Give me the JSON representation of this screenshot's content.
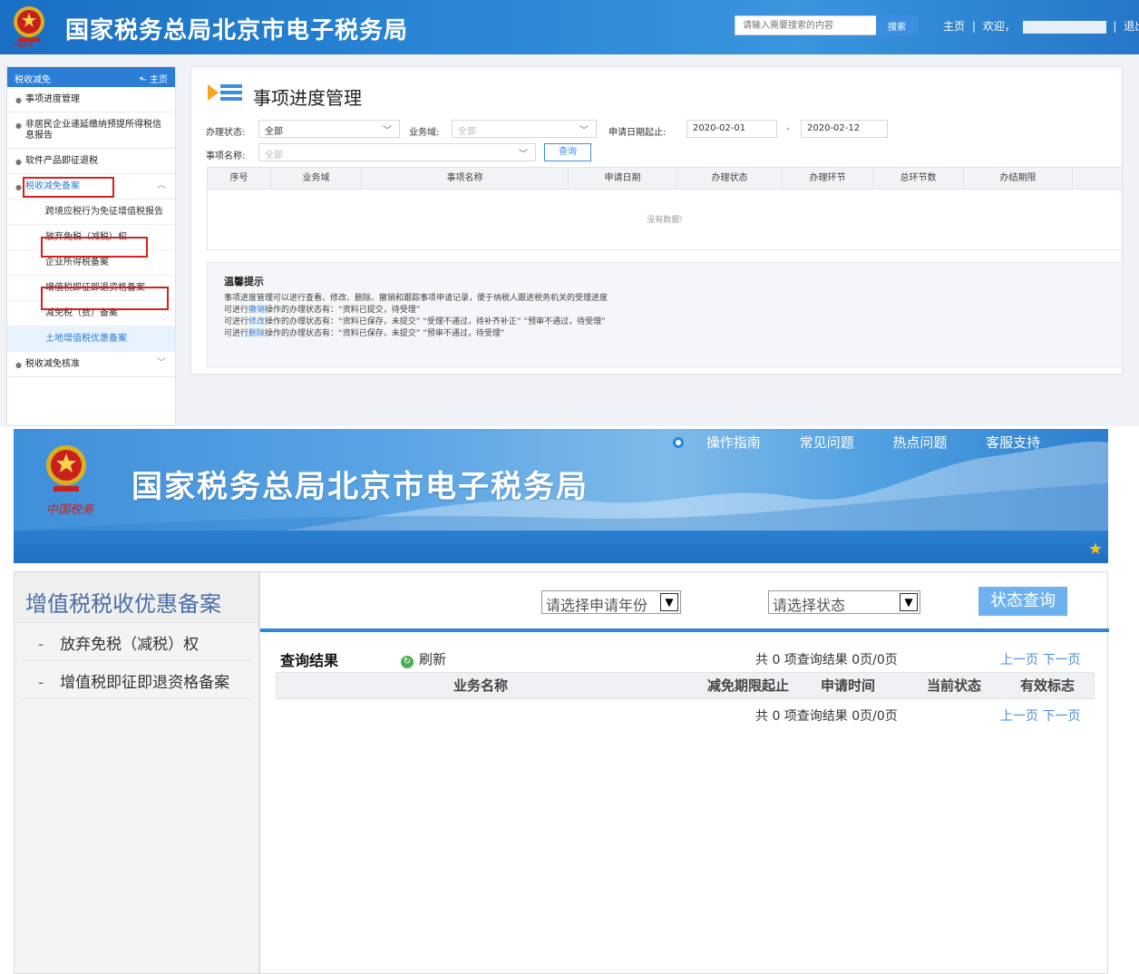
{
  "top": {
    "header": {
      "title": "国家税务总局北京市电子税务局",
      "search_placeholder": "请输入需要搜索的内容",
      "search_button": "搜索",
      "home": "主页",
      "sep1": "|",
      "welcome": "欢迎，",
      "sep2": "|",
      "logout": "退出"
    },
    "sidebar": {
      "head": "税收减免",
      "home": "主页",
      "items": [
        {
          "label": "事项进度管理"
        },
        {
          "label": "非居民企业递延缴纳预提所得税信息报告"
        },
        {
          "label": "软件产品即征退税"
        },
        {
          "label": "税收减免备案"
        }
      ],
      "subitems": [
        {
          "label": "跨境应税行为免征增值税报告"
        },
        {
          "label": "放弃免税（减税）权"
        },
        {
          "label": "企业所得税备案"
        },
        {
          "label": "增值税即征即退资格备案"
        },
        {
          "label": "减免税（费）备案"
        },
        {
          "label": "土地增值税优惠备案"
        }
      ],
      "last_item": "税收减免核准"
    },
    "main": {
      "title": "事项进度管理",
      "filters": {
        "status_label": "办理状态:",
        "status_value": "全部",
        "domain_label": "业务域:",
        "domain_value": "全部",
        "date_label": "申请日期起止:",
        "date_from": "2020-02-01",
        "date_sep": "-",
        "date_to": "2020-02-12",
        "name_label": "事项名称:",
        "name_value": "全部",
        "query_button": "查询"
      },
      "table": {
        "columns": [
          "序号",
          "业务域",
          "事项名称",
          "申请日期",
          "办理状态",
          "办理环节",
          "总环节数",
          "办结期限"
        ],
        "empty": "没有数据!"
      },
      "tips": {
        "title": "温馨提示",
        "line1": "事项进度管理可以进行查看、修改、删除、撤销和跟踪事项申请记录，便于纳税人跟进税务机关的受理进度",
        "line2_pre": "可进行",
        "line2_hl": "撤销",
        "line2_post": "操作的办理状态有：“资料已提交，待受理”",
        "line3_pre": "可进行",
        "line3_hl": "修改",
        "line3_post": "操作的办理状态有：“资料已保存，未提交” “受理不通过，待补齐补正” “预审不通过，待受理”",
        "line4_pre": "可进行",
        "line4_hl": "删除",
        "line4_post": "操作的办理状态有：“资料已保存，未提交” “预审不通过，待受理”"
      }
    }
  },
  "bottom": {
    "banner": {
      "title": "国家税务总局北京市电子税务局",
      "seal": "中国税务",
      "links": [
        "操作指南",
        "常见问题",
        "热点问题",
        "客服支持"
      ]
    },
    "sidebar": {
      "title": "增值税税收优惠备案",
      "items": [
        {
          "dash": "-",
          "label": "放弃免税（减税）权"
        },
        {
          "dash": "-",
          "label": "增值税即征即退资格备案"
        }
      ]
    },
    "main": {
      "year_select": "请选择申请年份",
      "status_select": "请选择状态",
      "query_button": "状态查询",
      "result_title": "查询结果",
      "refresh": "刷新",
      "count_text": "共 0 项查询结果 0页/0页",
      "prev": "上一页",
      "next": "下一页",
      "columns": [
        "业务名称",
        "减免期限起止",
        "申请时间",
        "当前状态",
        "有效标志"
      ]
    }
  },
  "colors": {
    "brand_blue": "#2b7dd6",
    "highlight_red": "#d61f1f",
    "link_blue": "#4a8ed8"
  }
}
